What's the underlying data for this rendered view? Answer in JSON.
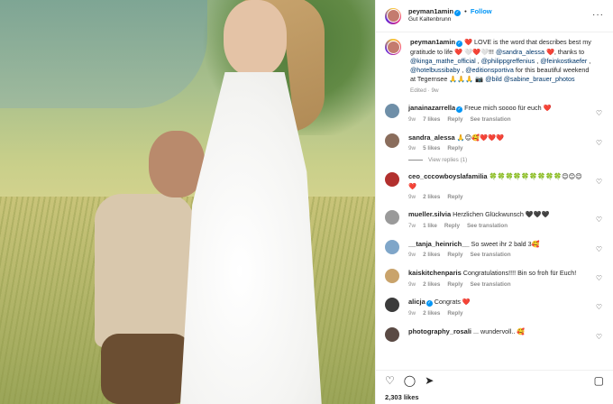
{
  "post_header": {
    "username": "peyman1amin",
    "separator": "•",
    "follow_label": "Follow",
    "location": "Gut Kaltenbrunn",
    "more_icon": "more-horizontal-icon"
  },
  "caption": {
    "username": "peyman1amin",
    "text_1": "❤️ LOVE is the word that describes best my gratitude to life ❤️ 🤍❤️🤍!!! ",
    "mention_1": "@sandra_alessa",
    "text_2": " ❤️, thanks to ",
    "mention_2": "@kinga_mathe_official",
    "text_3": " , ",
    "mention_3": "@philippgreffenius",
    "text_4": " , ",
    "mention_4": "@feinkostkaefer",
    "text_5": " , ",
    "mention_5": "@hotelbussibaby",
    "text_6": " , ",
    "mention_6": "@editionsportiva",
    "text_7": " for this beautiful weekend at Tegernsee 🙏🙏🙏 📷 ",
    "mention_7": "@bild",
    "text_8": " ",
    "mention_8": "@sabine_brauer_photos",
    "meta": "Edited · 9w"
  },
  "comments": [
    {
      "username": "janainazarrella",
      "verified": true,
      "text": "Freue mich soooo für euch ❤️",
      "age": "9w",
      "likes": "7 likes",
      "reply": "Reply",
      "translate": "See translation",
      "avatar_color": "#6f8fa8"
    },
    {
      "username": "sandra_alessa",
      "verified": false,
      "text": "🙏😊🥰❤️❤️❤️",
      "age": "9w",
      "likes": "5 likes",
      "reply": "Reply",
      "translate": "",
      "avatar_color": "#8a6d5c",
      "view_replies": "View replies (1)"
    },
    {
      "username": "ceo_cccowboyslafamilia",
      "verified": false,
      "text": "🍀🍀🍀🍀🍀🍀🍀🍀🍀😊😊😊❤️",
      "age": "9w",
      "likes": "2 likes",
      "reply": "Reply",
      "translate": "",
      "avatar_color": "#b2302e"
    },
    {
      "username": "mueller.silvia",
      "verified": false,
      "text": "Herzlichen Glückwunsch 🖤🖤🖤",
      "age": "7w",
      "likes": "1 like",
      "reply": "Reply",
      "translate": "See translation",
      "avatar_color": "#9a9a9a"
    },
    {
      "username": "__tanja_heinrich__",
      "verified": false,
      "text": "So sweet ihr 2 bald 3🥰",
      "age": "9w",
      "likes": "2 likes",
      "reply": "Reply",
      "translate": "See translation",
      "avatar_color": "#7fa6c9"
    },
    {
      "username": "kaiskitchenparis",
      "verified": false,
      "text": "Congratulations!!!! Bin so froh für Euch!",
      "age": "9w",
      "likes": "2 likes",
      "reply": "Reply",
      "translate": "See translation",
      "avatar_color": "#c9a36b"
    },
    {
      "username": "alicja",
      "verified": true,
      "text": "Congrats ❤️",
      "age": "9w",
      "likes": "2 likes",
      "reply": "Reply",
      "translate": "",
      "avatar_color": "#3b3b3b"
    },
    {
      "username": "photography_rosali",
      "verified": false,
      "text": "... wundervoll.. 🥰",
      "age": "",
      "likes": "",
      "reply": "",
      "translate": "",
      "avatar_color": "#5a4a44"
    }
  ],
  "actions": {
    "like_icon": "heart-outline-icon",
    "comment_icon": "comment-icon",
    "share_icon": "share-paper-plane-icon",
    "save_icon": "bookmark-icon"
  },
  "likes_count": "2,303 likes",
  "verified_mark": "✓",
  "heart_glyph": "♡",
  "glyphs": {
    "heart": "♡",
    "comment": "◯",
    "share": "➤",
    "save": "▢",
    "more": "···"
  }
}
